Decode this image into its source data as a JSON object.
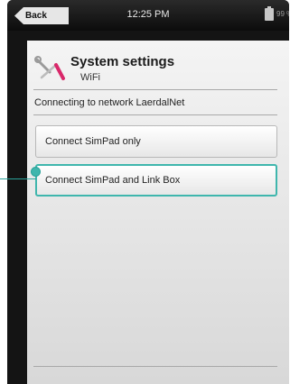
{
  "statusbar": {
    "back_label": "Back",
    "time": "12:25 PM",
    "battery": "99 %"
  },
  "header": {
    "icon": "tools-icon",
    "title": "System settings",
    "subtitle": "WiFi"
  },
  "status": {
    "text": "Connecting to network LaerdalNet"
  },
  "options": [
    {
      "label": "Connect SimPad only",
      "selected": false
    },
    {
      "label": "Connect SimPad and Link Box",
      "selected": true
    }
  ],
  "colors": {
    "accent": "#3fb6ad",
    "bezel": "#141414"
  }
}
